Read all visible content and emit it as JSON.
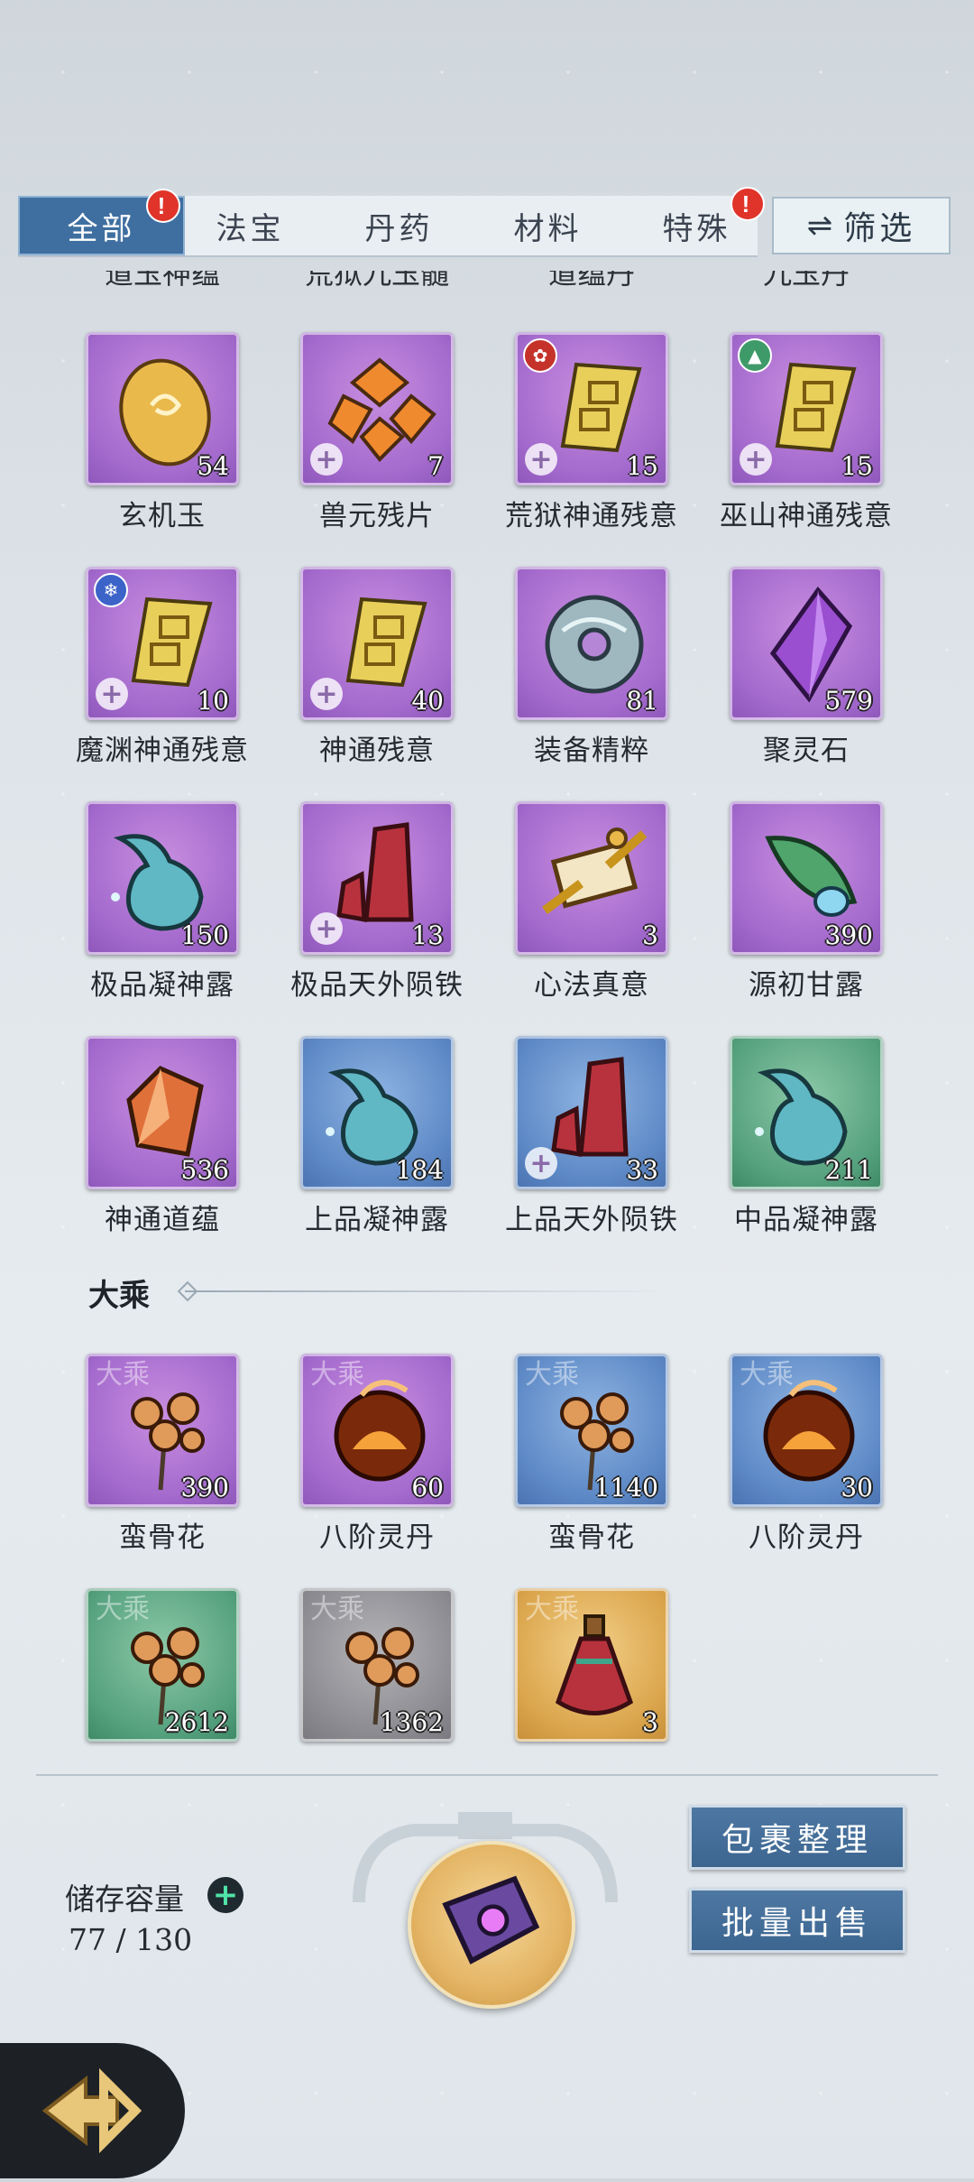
{
  "tabs": [
    {
      "label": "全部",
      "active": true,
      "badge": "!"
    },
    {
      "label": "法宝",
      "active": false,
      "badge": ""
    },
    {
      "label": "丹药",
      "active": false,
      "badge": ""
    },
    {
      "label": "材料",
      "active": false,
      "badge": ""
    },
    {
      "label": "特殊",
      "active": false,
      "badge": "!"
    }
  ],
  "filter": {
    "label": "筛选",
    "icon": "swap-arrows-icon"
  },
  "clipped_names": [
    "道玉神蕴",
    "荒狱九玉髓",
    "道蕴丹",
    "九玉丹"
  ],
  "items_top": [
    {
      "name": "玄机玉",
      "count": "54",
      "rarity": "purple",
      "icon": "jade-stone-icon"
    },
    {
      "name": "兽元残片",
      "count": "7",
      "rarity": "purple",
      "icon": "shards-icon",
      "plus": "+"
    },
    {
      "name": "荒狱神通残意",
      "count": "15",
      "rarity": "purple",
      "icon": "scroll-fragment-icon",
      "plus": "+",
      "sect_color": "#c5322a"
    },
    {
      "name": "巫山神通残意",
      "count": "15",
      "rarity": "purple",
      "icon": "scroll-fragment-icon",
      "plus": "+",
      "sect_color": "#3f9a6a"
    },
    {
      "name": "魔渊神通残意",
      "count": "10",
      "rarity": "purple",
      "icon": "scroll-fragment-icon",
      "plus": "+",
      "sect_color": "#3b63c8"
    },
    {
      "name": "神通残意",
      "count": "40",
      "rarity": "purple",
      "icon": "scroll-fragment-icon",
      "plus": "+"
    },
    {
      "name": "装备精粹",
      "count": "81",
      "rarity": "purple",
      "icon": "ring-disc-icon"
    },
    {
      "name": "聚灵石",
      "count": "579",
      "rarity": "purple",
      "icon": "crystal-icon"
    },
    {
      "name": "极品凝神露",
      "count": "150",
      "rarity": "purple",
      "icon": "dew-drop-icon"
    },
    {
      "name": "极品天外陨铁",
      "count": "13",
      "rarity": "purple",
      "icon": "red-crystal-icon",
      "plus": "+"
    },
    {
      "name": "心法真意",
      "count": "3",
      "rarity": "purple",
      "icon": "golden-artifact-icon"
    },
    {
      "name": "源初甘露",
      "count": "390",
      "rarity": "purple",
      "icon": "leaf-dew-icon"
    },
    {
      "name": "神通道蕴",
      "count": "536",
      "rarity": "purple",
      "icon": "amber-crystal-icon"
    },
    {
      "name": "上品凝神露",
      "count": "184",
      "rarity": "blue",
      "icon": "dew-drop-icon"
    },
    {
      "name": "上品天外陨铁",
      "count": "33",
      "rarity": "blue",
      "icon": "red-crystal-icon",
      "plus": "+"
    },
    {
      "name": "中品凝神露",
      "count": "211",
      "rarity": "green",
      "icon": "dew-drop-icon"
    }
  ],
  "section": {
    "title": "大乘"
  },
  "items_bottom": [
    {
      "name": "蛮骨花",
      "count": "390",
      "rarity": "purple",
      "icon": "flower-icon",
      "tag": "大乘"
    },
    {
      "name": "八阶灵丹",
      "count": "60",
      "rarity": "purple",
      "icon": "fire-pill-icon",
      "tag": "大乘"
    },
    {
      "name": "蛮骨花",
      "count": "1140",
      "rarity": "blue",
      "icon": "flower-icon",
      "tag": "大乘"
    },
    {
      "name": "八阶灵丹",
      "count": "30",
      "rarity": "blue",
      "icon": "fire-pill-icon",
      "tag": "大乘"
    },
    {
      "name": "",
      "count": "2612",
      "rarity": "green",
      "icon": "flower-icon",
      "tag": "大乘"
    },
    {
      "name": "",
      "count": "1362",
      "rarity": "gray",
      "icon": "flower-icon",
      "tag": "大乘"
    },
    {
      "name": "",
      "count": "3",
      "rarity": "gold",
      "icon": "potion-bottle-icon",
      "tag": "大乘"
    }
  ],
  "storage": {
    "label": "储存容量",
    "value": "77 / 130"
  },
  "buttons": {
    "organize": "包裹整理",
    "batch_sell": "批量出售"
  },
  "colors": {
    "accent": "#3f6fa0",
    "purple": "#a46acd",
    "blue": "#5d89c6",
    "green": "#57a27f",
    "gray": "#8c8c92",
    "gold": "#dba64d"
  }
}
